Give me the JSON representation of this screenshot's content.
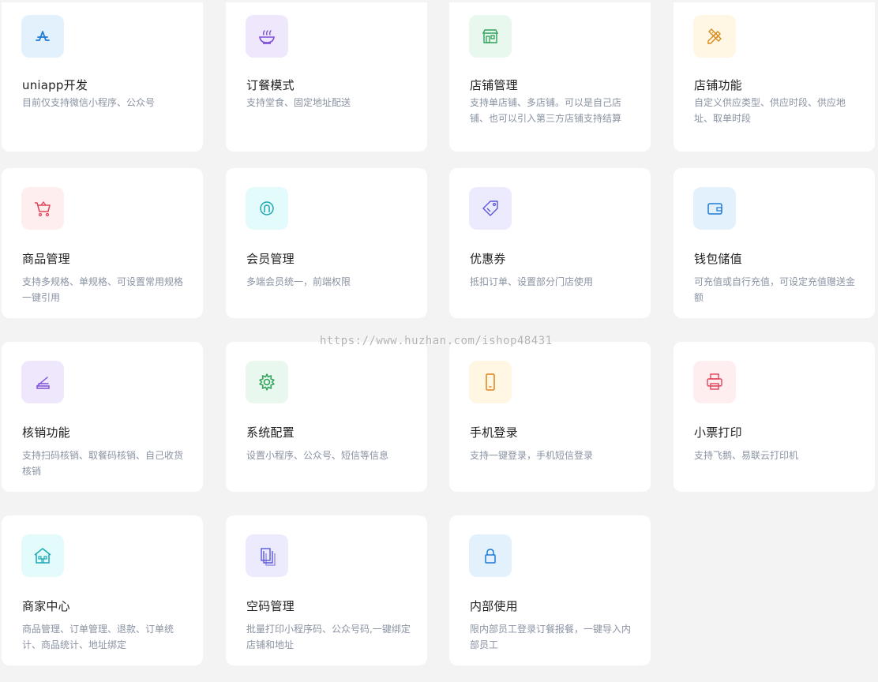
{
  "watermark": "https://www.huzhan.com/ishop48431",
  "cards": [
    {
      "title": "uniapp开发",
      "desc": "目前仅支持微信小程序、公众号",
      "icon": "app-store-icon",
      "bg": "#e3f1fd",
      "color": "#1e7ad6"
    },
    {
      "title": "订餐模式",
      "desc": "支持堂食、固定地址配送",
      "icon": "noodle-bowl-icon",
      "bg": "#efe8fd",
      "color": "#7e4ed8"
    },
    {
      "title": "店铺管理",
      "desc": "支持单店铺、多店铺。可以是自己店铺、也可以引入第三方店铺支持结算",
      "icon": "storefront-icon",
      "bg": "#e8f8ee",
      "color": "#2fa35a"
    },
    {
      "title": "店铺功能",
      "desc": "自定义供应类型、供应时段、供应地址、取单时段",
      "icon": "ruler-pencil-icon",
      "bg": "#fff7e3",
      "color": "#d98a1a"
    },
    {
      "title": "商品管理",
      "desc": "支持多规格、单规格、可设置常用规格一键引用",
      "icon": "shopping-cart-icon",
      "bg": "#ffeef0",
      "color": "#e0445a"
    },
    {
      "title": "会员管理",
      "desc": "多端会员统一，前端权限",
      "icon": "member-icon",
      "bg": "#e4fbfb",
      "color": "#1aa8b5"
    },
    {
      "title": "优惠券",
      "desc": "抵扣订单、设置部分门店使用",
      "icon": "coupon-tag-icon",
      "bg": "#ecebfd",
      "color": "#5b57d6"
    },
    {
      "title": "钱包储值",
      "desc": "可充值或自行充值，可设定充值赠送金额",
      "icon": "wallet-icon",
      "bg": "#e3f1fd",
      "color": "#1e7ad6"
    },
    {
      "title": "核销功能",
      "desc": "支持扫码核销、取餐码核销、自己收货核销",
      "icon": "scanner-icon",
      "bg": "#efe8fd",
      "color": "#7e4ed8"
    },
    {
      "title": "系统配置",
      "desc": "设置小程序、公众号、短信等信息",
      "icon": "gear-icon",
      "bg": "#e8f8ee",
      "color": "#2fa35a"
    },
    {
      "title": "手机登录",
      "desc": "支持一键登录，手机短信登录",
      "icon": "mobile-phone-icon",
      "bg": "#fff7e3",
      "color": "#e0821a"
    },
    {
      "title": "小票打印",
      "desc": "支持飞鹅、易联云打印机",
      "icon": "printer-icon",
      "bg": "#ffeef0",
      "color": "#e0445a"
    },
    {
      "title": "商家中心",
      "desc": "商品管理、订单管理、退款、订单统计、商品统计、地址绑定",
      "icon": "merchant-house-icon",
      "bg": "#e4fbfb",
      "color": "#1aa8b5"
    },
    {
      "title": "空码管理",
      "desc": "批量打印小程序码、公众号码,一键绑定店铺和地址",
      "icon": "documents-icon",
      "bg": "#ecebfd",
      "color": "#5b57d6"
    },
    {
      "title": "内部使用",
      "desc": "限内部员工登录订餐报餐，一键导入内部员工",
      "icon": "lock-icon",
      "bg": "#e3f1fd",
      "color": "#1e7ad6"
    }
  ]
}
